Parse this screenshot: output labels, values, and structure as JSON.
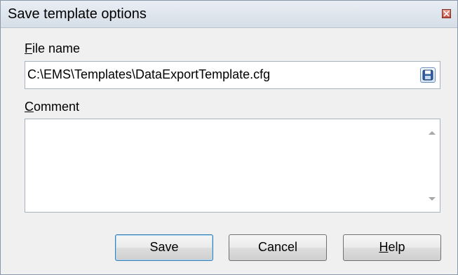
{
  "dialog": {
    "title": "Save template options"
  },
  "file_name": {
    "label_accel": "F",
    "label_rest": "ile name",
    "value": "C:\\EMS\\Templates\\DataExportTemplate.cfg"
  },
  "comment": {
    "label_accel": "C",
    "label_rest": "omment",
    "value": ""
  },
  "buttons": {
    "save": "Save",
    "cancel": "Cancel",
    "help_accel": "H",
    "help_rest": "elp"
  },
  "icons": {
    "close": "close-icon",
    "save_file": "floppy-disk-icon",
    "scroll_up": "scroll-up-arrow-icon",
    "scroll_down": "scroll-down-arrow-icon"
  },
  "colors": {
    "titlebar": "#dde4ec",
    "close_button": "#c4513f",
    "default_button_border": "#3c7fb1"
  }
}
